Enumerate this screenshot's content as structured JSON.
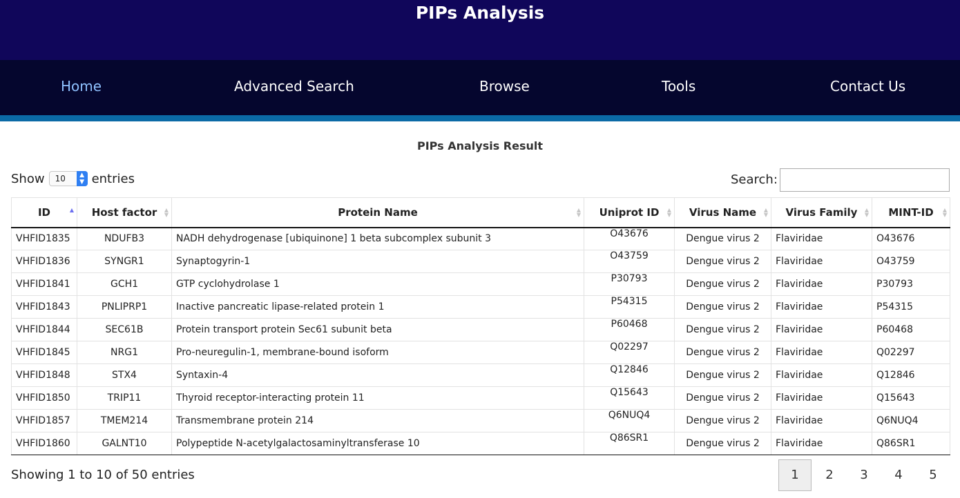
{
  "header": {
    "title": "PIPs Analysis"
  },
  "nav": {
    "home": "Home",
    "advanced_search": "Advanced Search",
    "browse": "Browse",
    "tools": "Tools",
    "contact": "Contact Us"
  },
  "result": {
    "title": "PIPs Analysis Result",
    "show_label": "Show",
    "entries_label": "entries",
    "length_value": "10",
    "search_label": "Search:",
    "search_value": "",
    "info": "Showing 1 to 10 of 50 entries"
  },
  "table": {
    "headers": [
      "ID",
      "Host factor",
      "Protein Name",
      "Uniprot ID",
      "Virus Name",
      "Virus Family",
      "MINT-ID"
    ],
    "sorted_column": "ID",
    "sort_direction": "ascending",
    "rows": [
      [
        "VHFID1835",
        "NDUFB3",
        "NADH dehydrogenase [ubiquinone] 1 beta subcomplex subunit 3",
        "O43676",
        "Dengue virus 2",
        "Flaviridae",
        "O43676"
      ],
      [
        "VHFID1836",
        "SYNGR1",
        "Synaptogyrin-1",
        "O43759",
        "Dengue virus 2",
        "Flaviridae",
        "O43759"
      ],
      [
        "VHFID1841",
        "GCH1",
        "GTP cyclohydrolase 1",
        "P30793",
        "Dengue virus 2",
        "Flaviridae",
        "P30793"
      ],
      [
        "VHFID1843",
        "PNLIPRP1",
        "Inactive pancreatic lipase-related protein 1",
        "P54315",
        "Dengue virus 2",
        "Flaviridae",
        "P54315"
      ],
      [
        "VHFID1844",
        "SEC61B",
        "Protein transport protein Sec61 subunit beta",
        "P60468",
        "Dengue virus 2",
        "Flaviridae",
        "P60468"
      ],
      [
        "VHFID1845",
        "NRG1",
        "Pro-neuregulin-1, membrane-bound isoform",
        "Q02297",
        "Dengue virus 2",
        "Flaviridae",
        "Q02297"
      ],
      [
        "VHFID1848",
        "STX4",
        "Syntaxin-4",
        "Q12846",
        "Dengue virus 2",
        "Flaviridae",
        "Q12846"
      ],
      [
        "VHFID1850",
        "TRIP11",
        "Thyroid receptor-interacting protein 11",
        "Q15643",
        "Dengue virus 2",
        "Flaviridae",
        "Q15643"
      ],
      [
        "VHFID1857",
        "TMEM214",
        "Transmembrane protein 214",
        "Q6NUQ4",
        "Dengue virus 2",
        "Flaviridae",
        "Q6NUQ4"
      ],
      [
        "VHFID1860",
        "GALNT10",
        "Polypeptide N-acetylgalactosaminyltransferase 10",
        "Q86SR1",
        "Dengue virus 2",
        "Flaviridae",
        "Q86SR1"
      ]
    ]
  },
  "pagination": {
    "pages": [
      "1",
      "2",
      "3",
      "4",
      "5"
    ],
    "current": "1"
  },
  "colors": {
    "header_bg": "#10065a",
    "nav_bg": "#05062e",
    "stripe": "#0b6aa6",
    "link": "#1a6fd8",
    "active_nav": "#8fc1ff"
  }
}
